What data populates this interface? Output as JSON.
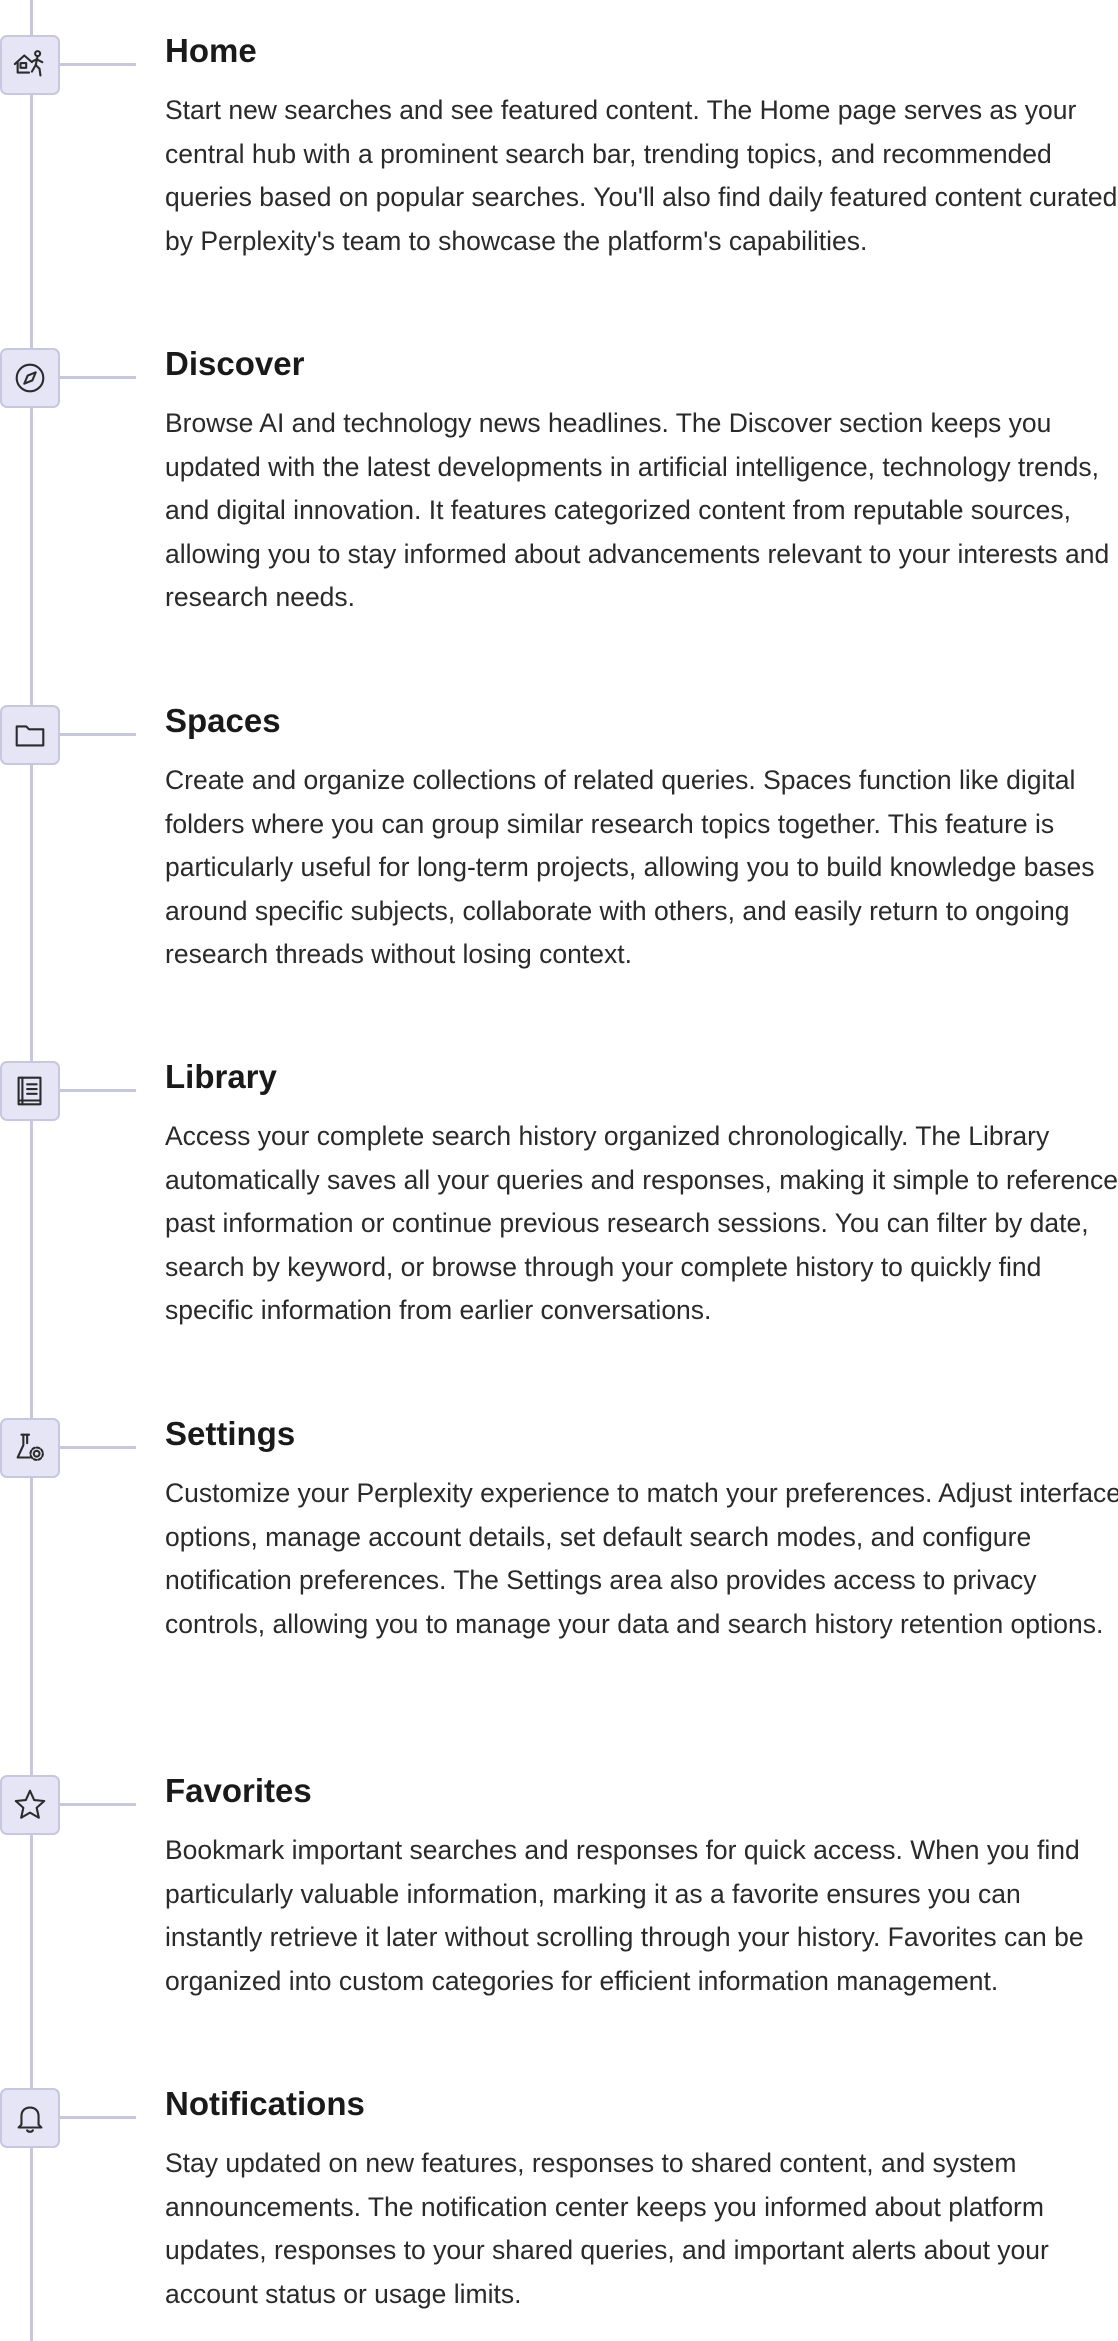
{
  "sections": [
    {
      "id": "home",
      "icon": "house-person-icon",
      "title": "Home",
      "description": "Start new searches and see featured content. The Home page serves as your central hub with a prominent search bar, trending topics, and recommended queries based on popular searches. You'll also find daily featured content curated by Perplexity's team to showcase the platform's capabilities."
    },
    {
      "id": "discover",
      "icon": "compass-icon",
      "title": "Discover",
      "description": "Browse AI and technology news headlines. The Discover section keeps you updated with the latest developments in artificial intelligence, technology trends, and digital innovation. It features categorized content from reputable sources, allowing you to stay informed about advancements relevant to your interests and research needs."
    },
    {
      "id": "spaces",
      "icon": "folder-icon",
      "title": "Spaces",
      "description": "Create and organize collections of related queries. Spaces function like digital folders where you can group similar research topics together. This feature is particularly useful for long-term projects, allowing you to build knowledge bases around specific subjects, collaborate with others, and easily return to ongoing research threads without losing context."
    },
    {
      "id": "library",
      "icon": "book-icon",
      "title": "Library",
      "description": "Access your complete search history organized chronologically. The Library automatically saves all your queries and responses, making it simple to reference past information or continue previous research sessions. You can filter by date, search by keyword, or browse through your complete history to quickly find specific information from earlier conversations."
    },
    {
      "id": "settings",
      "icon": "flask-gear-icon",
      "title": "Settings",
      "description": "Customize your Perplexity experience to match your preferences. Adjust interface options, manage account details, set default search modes, and configure notification preferences. The Settings area also provides access to privacy controls, allowing you to manage your data and search history retention options."
    },
    {
      "id": "favorites",
      "icon": "star-icon",
      "title": "Favorites",
      "description": "Bookmark important searches and responses for quick access. When you find particularly valuable information, marking it as a favorite ensures you can instantly retrieve it later without scrolling through your history. Favorites can be organized into custom categories for efficient information management."
    },
    {
      "id": "notifications",
      "icon": "bell-icon",
      "title": "Notifications",
      "description": "Stay updated on new features, responses to shared content, and system announcements. The notification center keeps you informed about platform updates, responses to your shared queries, and important alerts about your account status or usage limits."
    }
  ],
  "colors": {
    "timeline": "#c9c6e0",
    "icon_background": "#e6e5f6",
    "text": "#2a2a2a",
    "title": "#1a1a1a"
  }
}
